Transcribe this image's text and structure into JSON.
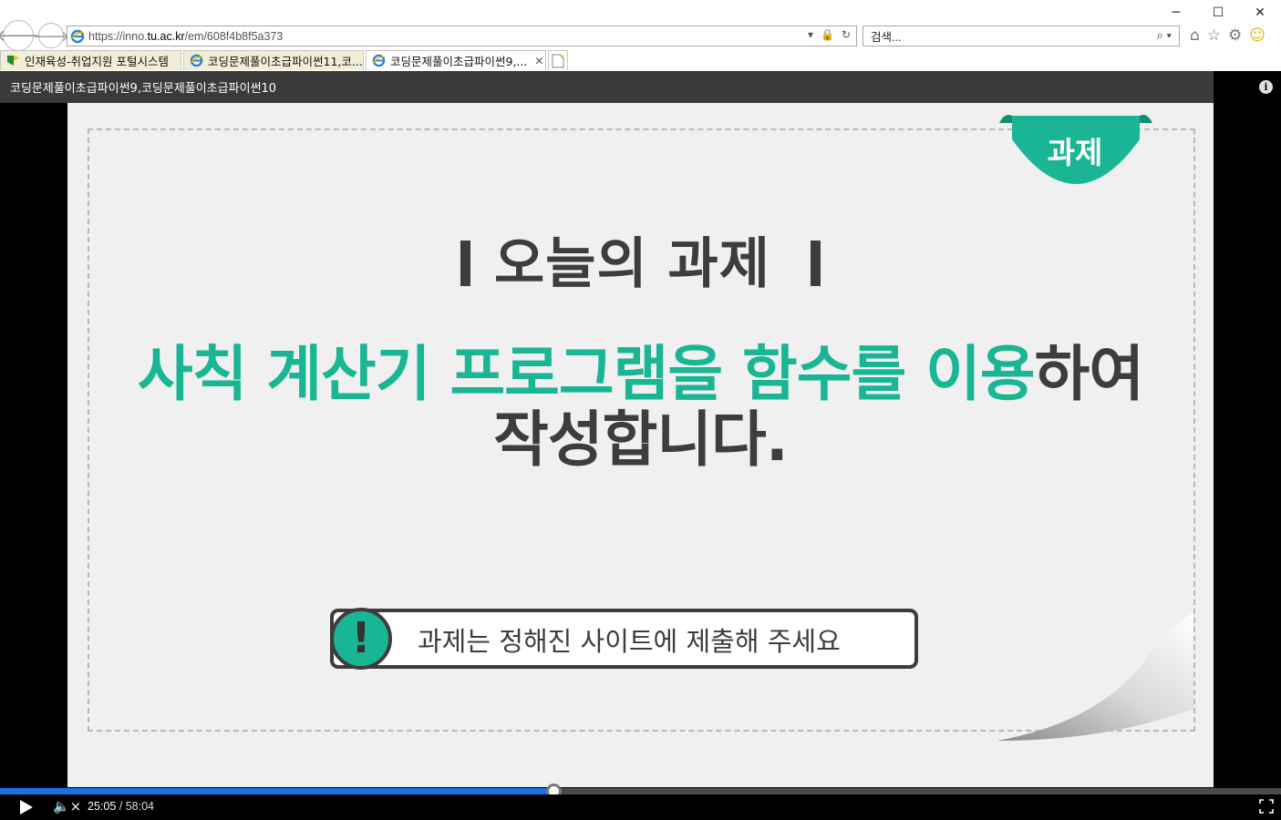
{
  "browser": {
    "url_prefix": "https://inno.",
    "url_host": "tu.ac.kr",
    "url_path": "/em/608f4b8f5a373",
    "search_placeholder": "검색...",
    "window_controls": {
      "minimize": "─",
      "maximize": "☐",
      "close": "✕"
    },
    "nav": {
      "back": "🡐",
      "forward": "🡒"
    },
    "address_tools": {
      "dropdown": "▾",
      "lock": "🔒",
      "refresh": "↻"
    },
    "search_icon": "⌕ ▾",
    "right_tools": {
      "home": "⌂",
      "favorites": "☆",
      "settings": "⚙",
      "smiley": "☺"
    }
  },
  "tabs": [
    {
      "label": "인재육성-취업지원 포털시스템",
      "icon": "portal-favicon",
      "active": false
    },
    {
      "label": "코딩문제풀이초급파이썬11,코...",
      "icon": "ie-favicon",
      "active": false
    },
    {
      "label": "코딩문제풀이초급파이썬9,...",
      "icon": "ie-favicon",
      "active": true,
      "close": "✕"
    }
  ],
  "player": {
    "title": "코딩문제풀이초급파이썬9,코딩문제풀이초급파이썬10",
    "info_glyph": "i",
    "current_time": "25:05",
    "separator": " / ",
    "total_time": "58:04",
    "progress_fraction": 0.432,
    "mute_glyph": "🔈×"
  },
  "slide": {
    "badge": "과제",
    "heading": "오늘의 과제",
    "task_highlight": "사칙 계산기 프로그램을 함수를 이용",
    "task_rest1": "하여",
    "task_line2": "작성합니다.",
    "notice_mark": "!",
    "notice": "과제는 정해진 사이트에 제출해 주세요"
  },
  "colors": {
    "accent": "#1ab594",
    "dark_text": "#3d3d3d",
    "progress": "#1a73e8",
    "slide_bg": "#f0f0f0"
  }
}
